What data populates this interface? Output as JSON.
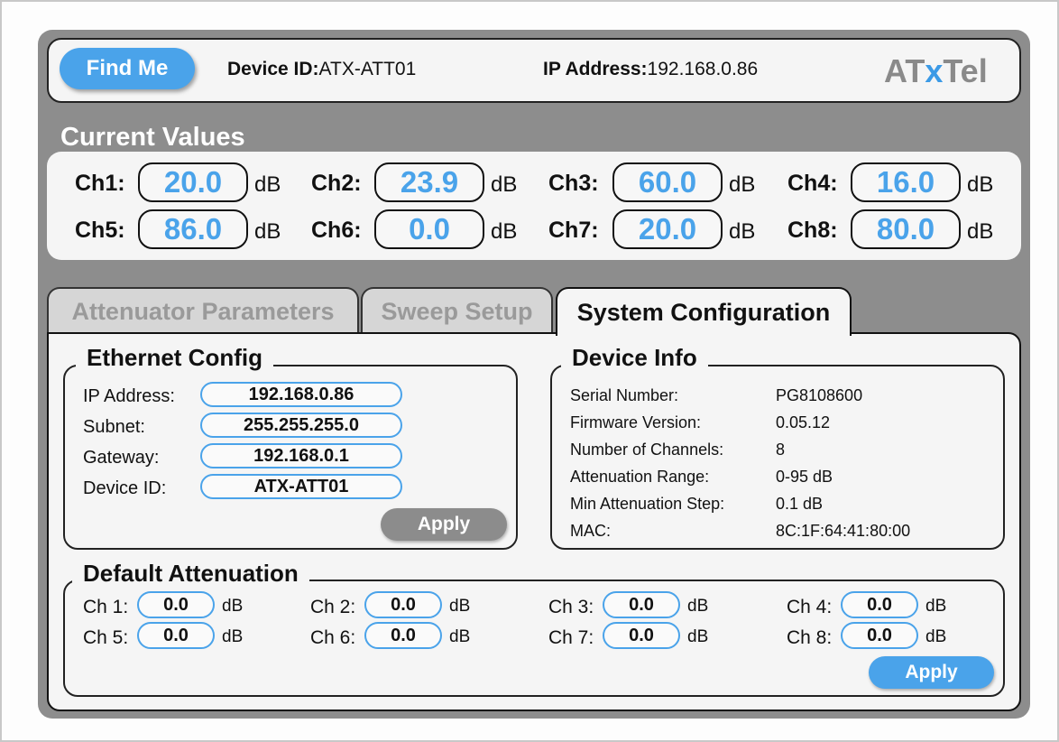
{
  "header": {
    "find_me_label": "Find Me",
    "device_id_label": "Device ID:",
    "device_id_value": "ATX-ATT01",
    "ip_label": "IP Address:",
    "ip_value": "192.168.0.86",
    "logo_at": "AT",
    "logo_x": "x",
    "logo_tel": "Tel"
  },
  "current_values": {
    "title": "Current Values",
    "unit": "dB",
    "channels": [
      {
        "label": "Ch1:",
        "value": "20.0"
      },
      {
        "label": "Ch2:",
        "value": "23.9"
      },
      {
        "label": "Ch3:",
        "value": "60.0"
      },
      {
        "label": "Ch4:",
        "value": "16.0"
      },
      {
        "label": "Ch5:",
        "value": "86.0"
      },
      {
        "label": "Ch6:",
        "value": "0.0"
      },
      {
        "label": "Ch7:",
        "value": "20.0"
      },
      {
        "label": "Ch8:",
        "value": "80.0"
      }
    ]
  },
  "tabs": [
    {
      "label": "Attenuator Parameters",
      "active": false
    },
    {
      "label": "Sweep Setup",
      "active": false
    },
    {
      "label": "System Configuration",
      "active": true
    }
  ],
  "ethernet": {
    "title": "Ethernet Config",
    "fields": [
      {
        "label": "IP Address:",
        "value": "192.168.0.86"
      },
      {
        "label": "Subnet:",
        "value": "255.255.255.0"
      },
      {
        "label": "Gateway:",
        "value": "192.168.0.1"
      },
      {
        "label": "Device ID:",
        "value": "ATX-ATT01"
      }
    ],
    "apply_label": "Apply"
  },
  "device_info": {
    "title": "Device Info",
    "rows": [
      {
        "label": "Serial Number:",
        "value": "PG8108600"
      },
      {
        "label": "Firmware Version:",
        "value": "0.05.12"
      },
      {
        "label": "Number of Channels:",
        "value": "8"
      },
      {
        "label": "Attenuation Range:",
        "value": "0-95 dB"
      },
      {
        "label": "Min Attenuation Step:",
        "value": "0.1 dB"
      },
      {
        "label": "MAC:",
        "value": "8C:1F:64:41:80:00"
      }
    ]
  },
  "default_attenuation": {
    "title": "Default Attenuation",
    "unit": "dB",
    "channels": [
      {
        "label": "Ch 1:",
        "value": "0.0"
      },
      {
        "label": "Ch 2:",
        "value": "0.0"
      },
      {
        "label": "Ch 3:",
        "value": "0.0"
      },
      {
        "label": "Ch 4:",
        "value": "0.0"
      },
      {
        "label": "Ch 5:",
        "value": "0.0"
      },
      {
        "label": "Ch 6:",
        "value": "0.0"
      },
      {
        "label": "Ch 7:",
        "value": "0.0"
      },
      {
        "label": "Ch 8:",
        "value": "0.0"
      }
    ],
    "apply_label": "Apply"
  },
  "colors": {
    "accent": "#4aa3ea",
    "panel": "#8d8d8d",
    "card": "#f5f5f5"
  }
}
